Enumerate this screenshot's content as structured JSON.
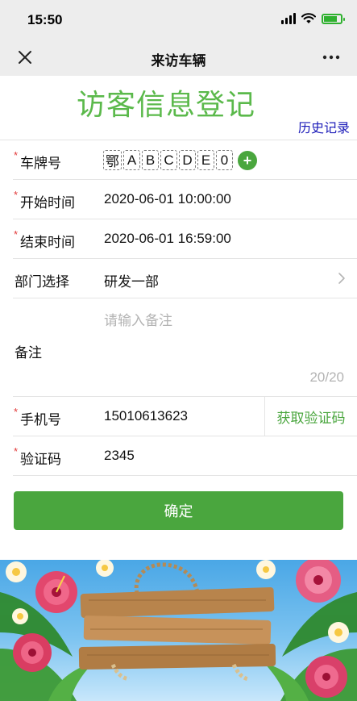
{
  "status_bar": {
    "time": "15:50"
  },
  "nav": {
    "title": "来访车辆",
    "close_icon": "close-icon",
    "more_icon": "more-icon"
  },
  "page": {
    "title": "访客信息登记",
    "history_link": "历史记录"
  },
  "form": {
    "plate": {
      "label": "车牌号",
      "required_mark": "*",
      "chars": [
        "鄂",
        "A",
        "B",
        "C",
        "D",
        "E",
        "0"
      ],
      "add_label": "+"
    },
    "start_time": {
      "label": "开始时间",
      "required_mark": "*",
      "value": "2020-06-01 10:00:00"
    },
    "end_time": {
      "label": "结束时间",
      "required_mark": "*",
      "value": "2020-06-01 16:59:00"
    },
    "department": {
      "label": "部门选择",
      "value": "研发一部",
      "icon": "chevron-right-icon"
    },
    "remark": {
      "label": "备注",
      "placeholder": "请输入备注",
      "counter": "20/20"
    },
    "phone": {
      "label": "手机号",
      "required_mark": "*",
      "value": "15010613623",
      "code_button": "获取验证码"
    },
    "code": {
      "label": "验证码",
      "required_mark": "*",
      "value": "2345"
    }
  },
  "confirm_button": "确定",
  "colors": {
    "accent": "#4aa63e",
    "title": "#5bb94b",
    "link": "#1a1ab8",
    "required": "#e23a3a",
    "chrome": "#ededed"
  }
}
